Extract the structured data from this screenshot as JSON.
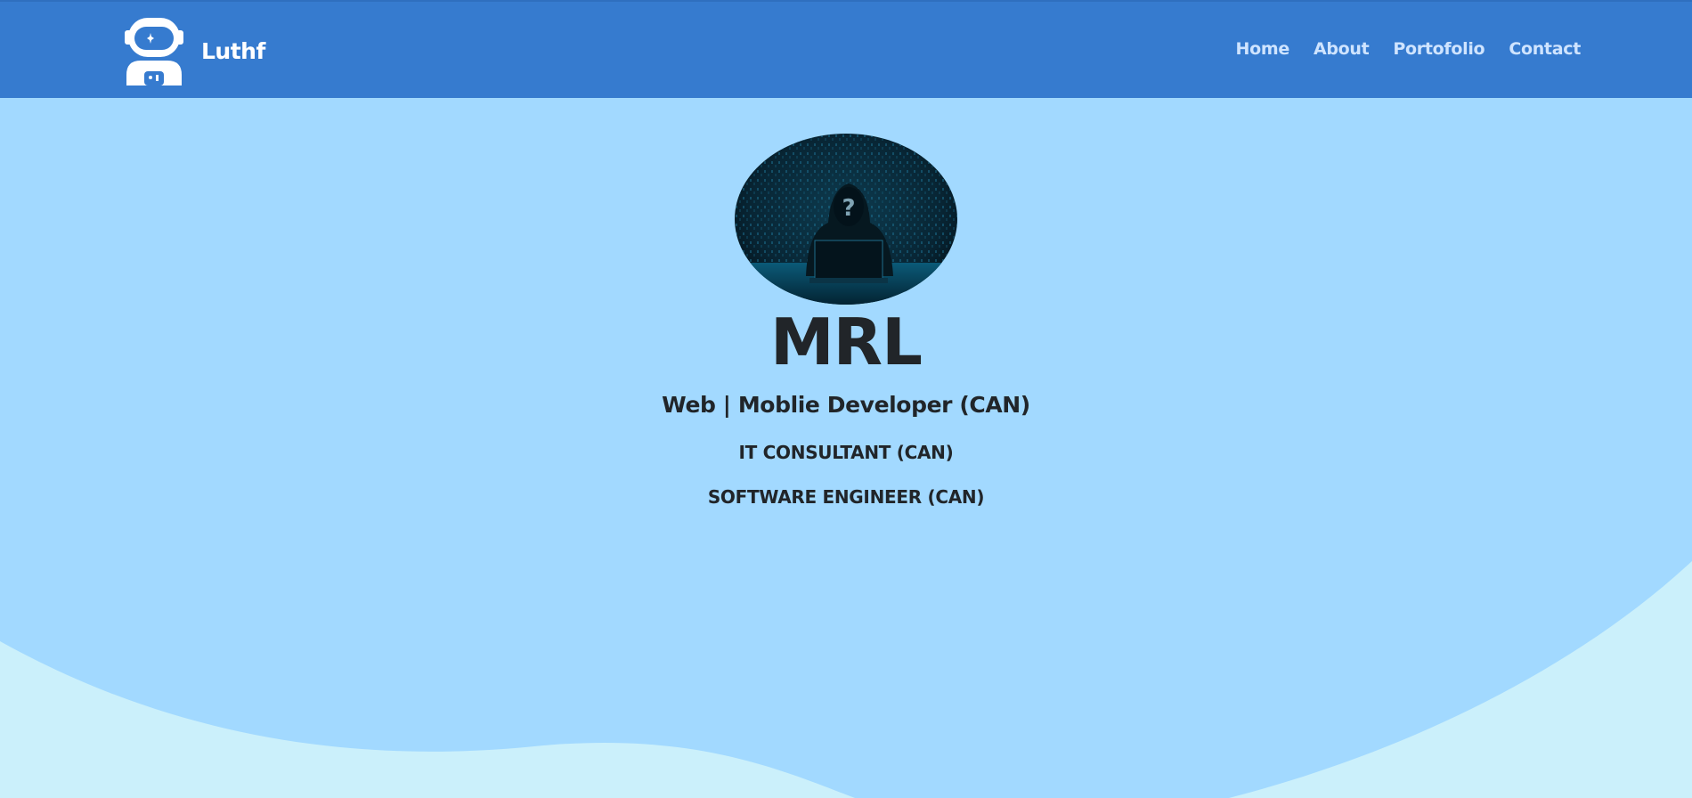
{
  "navbar": {
    "brand_name": "Luthf",
    "brand_icon": "astronaut-icon",
    "links": [
      {
        "label": "Home"
      },
      {
        "label": "About"
      },
      {
        "label": "Portofolio"
      },
      {
        "label": "Contact"
      }
    ],
    "background_color": "#367bcf",
    "link_color": "#cfe4ff"
  },
  "hero": {
    "avatar": "hooded-hacker-image",
    "name": "MRL",
    "role": "Web | Moblie Developer (CAN)",
    "subtitle_1": "IT CONSULTANT (CAN)",
    "subtitle_2": "SOFTWARE ENGINEER (CAN)",
    "background_color": "#a2d9ff",
    "wave_color": "#cbf0fb",
    "text_color": "#212529"
  }
}
